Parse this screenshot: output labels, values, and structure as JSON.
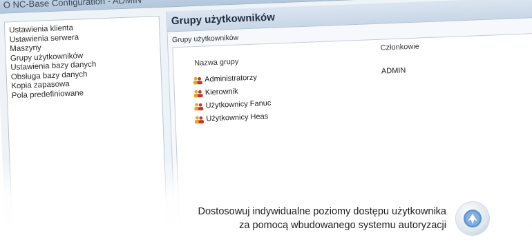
{
  "window": {
    "title": "O NC-Base Configuration - ADMIN"
  },
  "sidebar": {
    "items": [
      {
        "label": "Ustawienia klienta"
      },
      {
        "label": "Ustawienia serwera"
      },
      {
        "label": "Maszyny"
      },
      {
        "label": "Grupy użytkowników"
      },
      {
        "label": "Ustawienia bazy danych"
      },
      {
        "label": "Obsługa bazy danych"
      },
      {
        "label": "Kopia zapasowa"
      },
      {
        "label": "Pola predefiniowane"
      }
    ]
  },
  "main": {
    "title": "Grupy użytkowników",
    "group_label": "Grupy użytkowników",
    "columns": {
      "name": "Nazwa grupy",
      "members": "Członkowie"
    },
    "rows": [
      {
        "name": "Administratorzy",
        "members": "ADMIN",
        "icon": "users-icon"
      },
      {
        "name": "Kierownik",
        "members": "",
        "icon": "users-icon"
      },
      {
        "name": "Użytkownicy Fanuc",
        "members": "",
        "icon": "users-icon"
      },
      {
        "name": "Użytkownicy Heas",
        "members": "",
        "icon": "users-icon"
      }
    ]
  },
  "caption": {
    "line1": "Dostosowuj indywidualne poziomy dostępu użytkownika",
    "line2": "za pomocą wbudowanego systemu autoryzacji"
  },
  "colors": {
    "icon_red": "#c0392b",
    "icon_yellow": "#e0a82e",
    "badge_arrow": "#3b7fc4"
  }
}
